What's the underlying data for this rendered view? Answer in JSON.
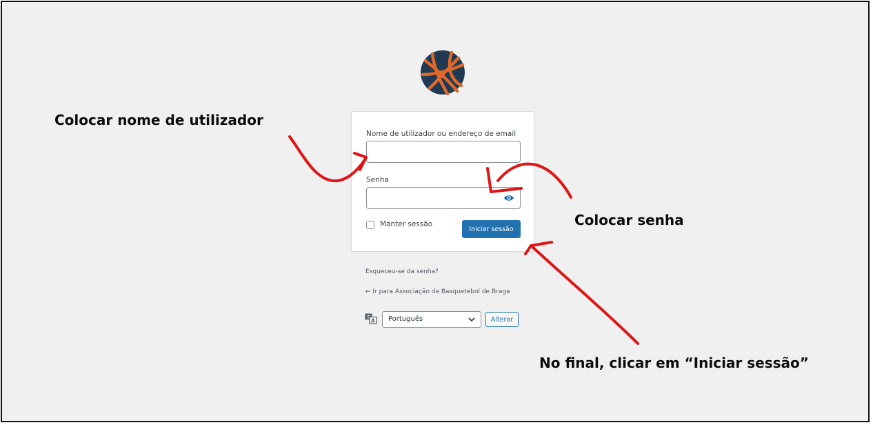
{
  "login": {
    "username_label": "Nome de utilizador ou endereço de email",
    "username_value": "",
    "password_label": "Senha",
    "password_value": "",
    "remember_label": "Manter sessão",
    "submit_label": "Iniciar sessão"
  },
  "links": {
    "lost_password": "Esqueceu-se da senha?",
    "back_to_site": "← Ir para Associação de Basquetebol de Braga"
  },
  "language": {
    "selected": "Português",
    "change_label": "Alterar"
  },
  "annotations": {
    "username": "Colocar nome de utilizador",
    "password": "Colocar senha",
    "submit": "No final, clicar em “Iniciar sessão”"
  },
  "colors": {
    "background": "#f0f0f1",
    "accent": "#2271b1",
    "arrow": "#e01414",
    "logo_ball": "#e0682a",
    "logo_bg": "#1f3a52"
  }
}
